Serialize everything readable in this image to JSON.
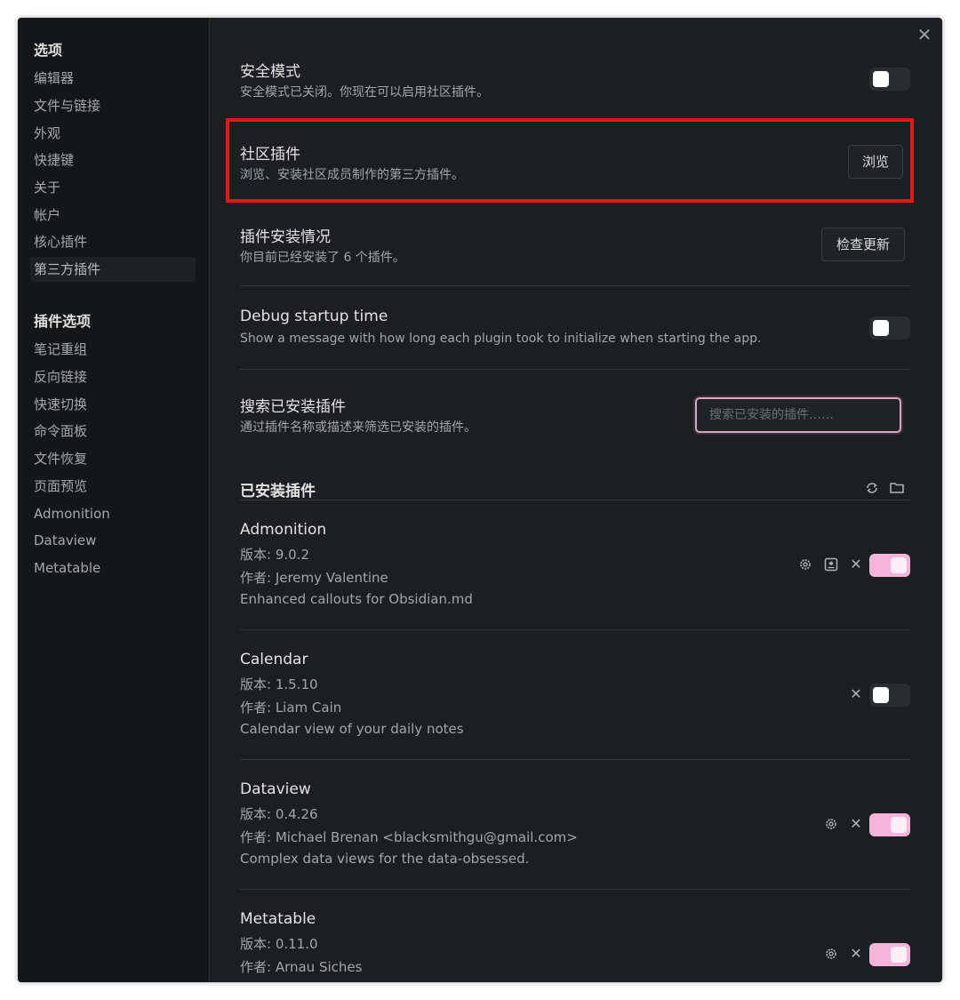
{
  "sidebar": {
    "heading_options": "选项",
    "options": [
      "编辑器",
      "文件与链接",
      "外观",
      "快捷键",
      "关于",
      "帐户",
      "核心插件",
      "第三方插件"
    ],
    "heading_plugin_options": "插件选项",
    "plugin_options": [
      "笔记重组",
      "反向链接",
      "快速切换",
      "命令面板",
      "文件恢复",
      "页面预览",
      "Admonition",
      "Dataview",
      "Metatable"
    ]
  },
  "close_symbol": "✕",
  "settings": {
    "safe_mode": {
      "title": "安全模式",
      "desc": "安全模式已关闭。你现在可以启用社区插件。"
    },
    "community": {
      "title": "社区插件",
      "desc": "浏览、安装社区成员制作的第三方插件。",
      "button": "浏览"
    },
    "installed_status": {
      "title": "插件安装情况",
      "desc": "你目前已经安装了 6 个插件。",
      "button": "检查更新"
    },
    "debug": {
      "title": "Debug startup time",
      "desc": "Show a message with how long each plugin took to initialize when starting the app."
    },
    "search": {
      "title": "搜索已安装插件",
      "desc": "通过插件名称或描述来筛选已安装的插件。",
      "placeholder": "搜索已安装的插件……"
    }
  },
  "installed_heading": "已安装插件",
  "plugins": [
    {
      "name": "Admonition",
      "version": "版本: 9.0.2",
      "author": "作者:  Jeremy Valentine",
      "desc": "Enhanced callouts for Obsidian.md",
      "enabled": true
    },
    {
      "name": "Calendar",
      "version": "版本: 1.5.10",
      "author": "作者:  Liam Cain",
      "desc": "Calendar view of your daily notes",
      "enabled": false
    },
    {
      "name": "Dataview",
      "version": "版本: 0.4.26",
      "author": "作者:  Michael Brenan <blacksmithgu@gmail.com>",
      "desc": "Complex data views for the data-obsessed.",
      "enabled": true
    },
    {
      "name": "Metatable",
      "version": "版本: 0.11.0",
      "author": "作者:  Arnau Siches",
      "enabled": true
    }
  ],
  "colors": {
    "accent_toggle": "#f5b5da",
    "highlight_border": "#e01818",
    "panel_bg": "#1c1e21"
  }
}
